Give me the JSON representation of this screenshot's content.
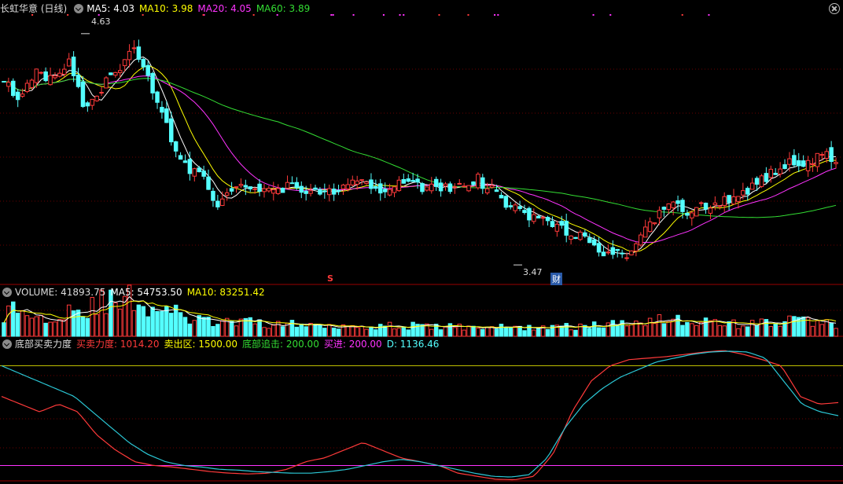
{
  "colors": {
    "up": "#ff3a3a",
    "down": "#54ffff",
    "ma5": "#ffffff",
    "ma10": "#ffff00",
    "ma20": "#ff33ff",
    "ma60": "#33dd33",
    "grid": "#6a0000",
    "signal": "#c0c000",
    "d_line": "#2bc8d6"
  },
  "icons": {
    "toggle": "chevron-down-icon",
    "close": "close-icon"
  },
  "main_header": {
    "title": "长虹华意 (日线)",
    "ma5": "MA5: 4.03",
    "ma10": "MA10: 3.98",
    "ma20": "MA20: 4.05",
    "ma60": "MA60: 3.89"
  },
  "volume_header": {
    "title": "VOLUME: 41893.75",
    "ma5": "MA5: 54753.50",
    "ma10": "MA10: 83251.42"
  },
  "indicator_header": {
    "title": "底部买卖力度",
    "force": "买卖力度: 1014.20",
    "sell_zone": "卖出区: 1500.00",
    "bottom": "底部追击: 200.00",
    "buy": "买进: 200.00",
    "d": "D: 1136.46"
  },
  "annotations": {
    "high_label": "4.63",
    "low_label": "3.47",
    "s_flag": "S",
    "cai_flag": "财"
  },
  "chart_data": [
    {
      "type": "candlestick",
      "ylim": [
        3.38,
        4.72
      ],
      "high": 4.63,
      "low": 3.47,
      "close_path": [
        4.42,
        4.28,
        4.45,
        4.38,
        4.48,
        4.22,
        4.36,
        4.43,
        4.57,
        4.38,
        4.15,
        3.98,
        3.92,
        3.78,
        3.82,
        3.88,
        3.85,
        3.86,
        3.87,
        3.84,
        3.85,
        3.86,
        3.89,
        3.85,
        3.87,
        3.86,
        3.87,
        3.86,
        3.87,
        3.9,
        3.85,
        3.77,
        3.73,
        3.7,
        3.67,
        3.62,
        3.58,
        3.52,
        3.51,
        3.6,
        3.72,
        3.77,
        3.73,
        3.77,
        3.78,
        3.82,
        3.87,
        3.93,
        3.98,
        3.95,
        4.03,
        4.0
      ]
    },
    {
      "type": "bar",
      "title": "VOLUME",
      "ylim": [
        0,
        200000
      ],
      "values": [
        120000,
        150000,
        90000,
        110000,
        160000,
        130000,
        185000,
        170000,
        210000,
        140000,
        155000,
        95000,
        80000,
        75000,
        70000,
        72000,
        68000,
        65000,
        60000,
        58000,
        62000,
        60000,
        55000,
        58000,
        52000,
        54000,
        50000,
        48000,
        52000,
        50000,
        48000,
        46000,
        45000,
        50000,
        48000,
        52000,
        55000,
        60000,
        70000,
        85000,
        100000,
        90000,
        80000,
        75000,
        70000,
        65000,
        68000,
        72000,
        80000,
        90000,
        75000,
        55000
      ]
    },
    {
      "type": "line",
      "title": "底部买卖力度",
      "ylim": [
        0,
        1700
      ],
      "sell_zone": 1500,
      "bottom_line": 200,
      "series": [
        {
          "name": "买卖力度",
          "values": [
            1100,
            1000,
            900,
            1000,
            900,
            600,
            400,
            250,
            200,
            180,
            150,
            120,
            100,
            90,
            100,
            150,
            250,
            300,
            400,
            500,
            400,
            300,
            250,
            200,
            100,
            60,
            20,
            15,
            60,
            350,
            900,
            1300,
            1500,
            1580,
            1600,
            1620,
            1650,
            1680,
            1700,
            1650,
            1580,
            1500,
            1100,
            1000,
            1020
          ]
        },
        {
          "name": "D",
          "values": [
            1500,
            1400,
            1300,
            1200,
            1100,
            900,
            700,
            500,
            350,
            250,
            200,
            180,
            150,
            140,
            120,
            110,
            100,
            100,
            120,
            150,
            200,
            250,
            280,
            250,
            200,
            150,
            100,
            60,
            50,
            80,
            300,
            700,
            1000,
            1200,
            1350,
            1450,
            1550,
            1600,
            1650,
            1680,
            1690,
            1680,
            1600,
            1300,
            1000,
            900,
            850
          ]
        }
      ]
    }
  ]
}
